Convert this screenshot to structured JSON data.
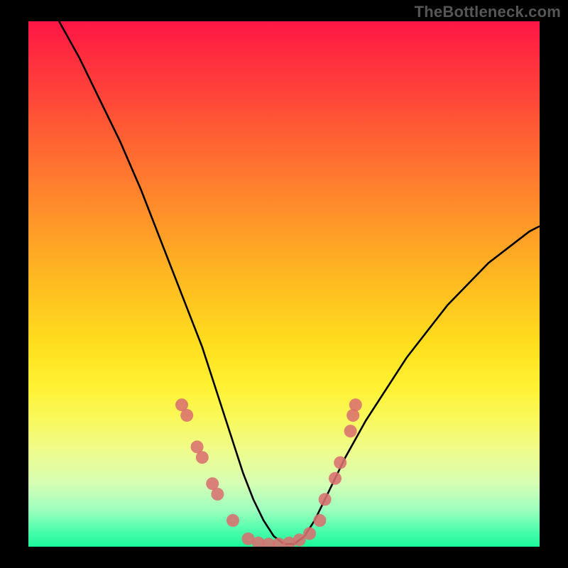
{
  "watermark": "TheBottleneck.com",
  "chart_data": {
    "type": "line",
    "title": "",
    "xlabel": "",
    "ylabel": "",
    "xlim": [
      0,
      100
    ],
    "ylim": [
      0,
      100
    ],
    "curve": {
      "note": "V-shaped bottleneck curve; values as percent of plot height from bottom (0=bottom, 100=top)",
      "x": [
        6,
        10,
        14,
        18,
        22,
        26,
        30,
        34,
        38,
        40,
        42,
        44,
        46,
        48,
        50,
        52,
        54,
        56,
        58,
        62,
        66,
        70,
        74,
        78,
        82,
        86,
        90,
        94,
        98,
        100
      ],
      "y": [
        100,
        93,
        85,
        77,
        68,
        58,
        48,
        38,
        26,
        20,
        14,
        9,
        5,
        2,
        0.5,
        0.5,
        2,
        5,
        9,
        17,
        24,
        30,
        36,
        41,
        46,
        50,
        54,
        57,
        60,
        61
      ]
    },
    "markers": {
      "note": "pink dot markers on the curve near the valley",
      "color": "#da6f6f",
      "points": [
        {
          "x": 30,
          "y": 27
        },
        {
          "x": 31,
          "y": 25
        },
        {
          "x": 33,
          "y": 19
        },
        {
          "x": 34,
          "y": 17
        },
        {
          "x": 36,
          "y": 12
        },
        {
          "x": 37,
          "y": 10
        },
        {
          "x": 40,
          "y": 5
        },
        {
          "x": 43,
          "y": 1.5
        },
        {
          "x": 45,
          "y": 0.7
        },
        {
          "x": 47,
          "y": 0.5
        },
        {
          "x": 49,
          "y": 0.5
        },
        {
          "x": 51,
          "y": 0.7
        },
        {
          "x": 53,
          "y": 1.3
        },
        {
          "x": 55,
          "y": 2.5
        },
        {
          "x": 57,
          "y": 5
        },
        {
          "x": 58,
          "y": 9
        },
        {
          "x": 60,
          "y": 13
        },
        {
          "x": 61,
          "y": 16
        },
        {
          "x": 63,
          "y": 22
        },
        {
          "x": 63.5,
          "y": 25
        },
        {
          "x": 64,
          "y": 27
        }
      ]
    },
    "gradient_stops": [
      {
        "pos": 0,
        "color": "#ff1646"
      },
      {
        "pos": 50,
        "color": "#ffc81f"
      },
      {
        "pos": 75,
        "color": "#fff235"
      },
      {
        "pos": 100,
        "color": "#1af89a"
      }
    ]
  }
}
